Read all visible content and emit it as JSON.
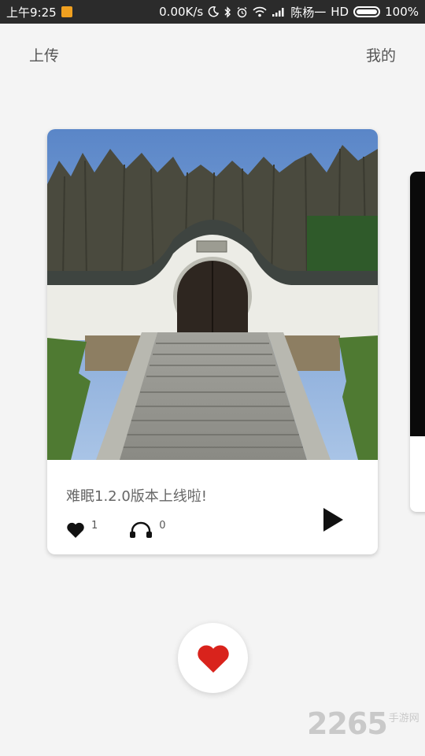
{
  "status_bar": {
    "time": "上午9:25",
    "speed": "0.00K/s",
    "carrier": "陈杨一",
    "network": "HD",
    "battery": "100%"
  },
  "header": {
    "left_label": "上传",
    "right_label": "我的"
  },
  "card": {
    "title": "难眠1.2.0版本上线啦!",
    "likes": "1",
    "listens": "0"
  },
  "watermark": {
    "number": "2265",
    "text": "手游网"
  },
  "colors": {
    "accent_heart": "#d9231c",
    "background": "#f4f4f4",
    "status_bar": "#2b2b2b"
  },
  "icons": [
    "app-notification-icon",
    "moon-icon",
    "bluetooth-icon",
    "alarm-icon",
    "wifi-icon",
    "signal-icon",
    "battery-icon",
    "heart-icon",
    "headphones-icon",
    "play-icon"
  ]
}
